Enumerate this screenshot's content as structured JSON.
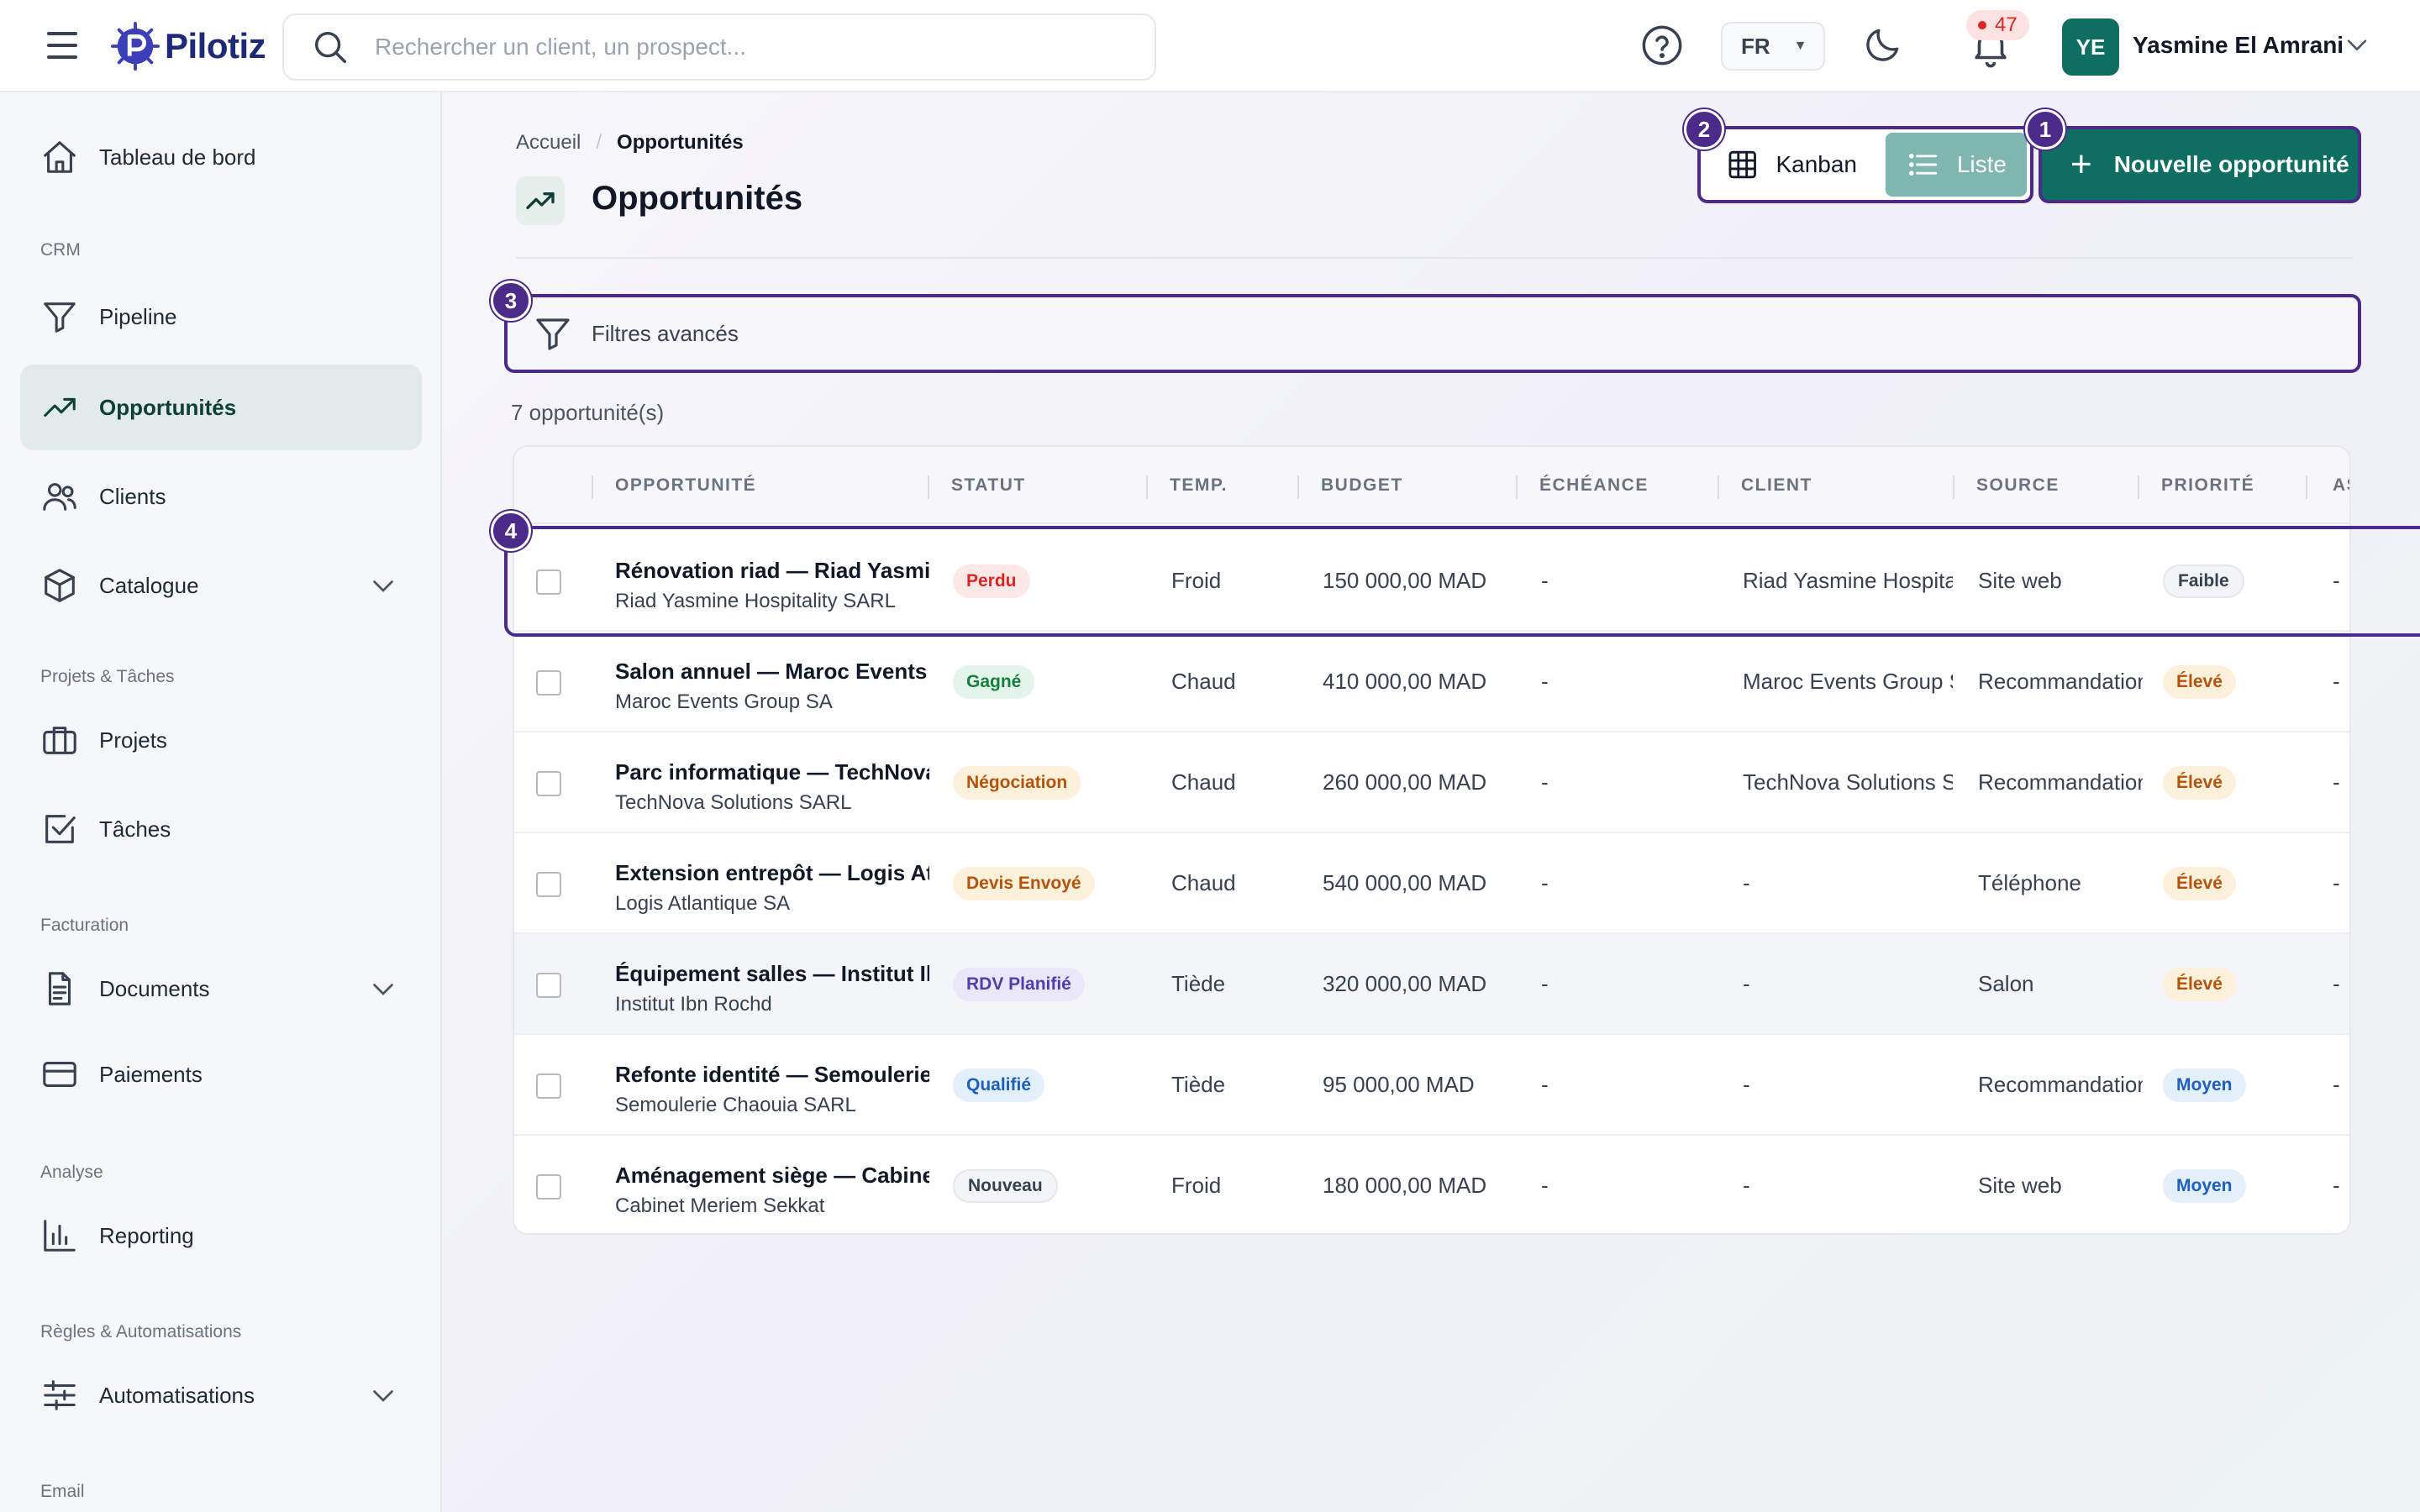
{
  "app": {
    "brand": "Pilotiz",
    "search_placeholder": "Rechercher un client, un prospect...",
    "language": "FR",
    "notifications_count": "47",
    "user_initials": "YE",
    "user_name": "Yasmine El Amrani"
  },
  "sidebar": {
    "items": [
      {
        "label": "Tableau de bord",
        "icon": "home-icon"
      },
      {
        "label": "Pipeline",
        "icon": "filter-icon"
      },
      {
        "label": "Opportunités",
        "icon": "trending-up-icon",
        "active": true
      },
      {
        "label": "Clients",
        "icon": "users-icon"
      },
      {
        "label": "Catalogue",
        "icon": "box-icon"
      },
      {
        "label": "Projets",
        "icon": "briefcase-icon"
      },
      {
        "label": "Tâches",
        "icon": "checkbox-icon"
      },
      {
        "label": "Documents",
        "icon": "document-icon"
      },
      {
        "label": "Paiements",
        "icon": "credit-card-icon"
      },
      {
        "label": "Reporting",
        "icon": "bar-chart-icon"
      },
      {
        "label": "Automatisations",
        "icon": "sliders-icon"
      }
    ],
    "sections": [
      "CRM",
      "Projets & Tâches",
      "Facturation",
      "Analyse",
      "Règles & Automatisations",
      "Email"
    ]
  },
  "page": {
    "breadcrumb_home": "Accueil",
    "breadcrumb_current": "Opportunités",
    "title": "Opportunités",
    "view_kanban": "Kanban",
    "view_list": "Liste",
    "new_button": "Nouvelle opportunité",
    "filters_label": "Filtres avancés",
    "count_label": "7 opportunité(s)",
    "markers": [
      "1",
      "2",
      "3",
      "4"
    ]
  },
  "table": {
    "columns": [
      "OPPORTUNITÉ",
      "STATUT",
      "TEMP.",
      "BUDGET",
      "ÉCHÉANCE",
      "CLIENT",
      "SOURCE",
      "PRIORITÉ",
      "AS"
    ],
    "rows": [
      {
        "title": "Rénovation riad — Riad Yasmine",
        "company": "Riad Yasmine Hospitality SARL",
        "status": "Perdu",
        "temp": "Froid",
        "budget": "150 000,00 MAD",
        "due": "-",
        "client": "Riad Yasmine Hospitality",
        "source": "Site web",
        "priority": "Faible",
        "assignee": "-"
      },
      {
        "title": "Salon annuel — Maroc Events Group",
        "company": "Maroc Events Group SA",
        "status": "Gagné",
        "temp": "Chaud",
        "budget": "410 000,00 MAD",
        "due": "-",
        "client": "Maroc Events Group SA",
        "source": "Recommandation",
        "priority": "Élevé",
        "assignee": "-"
      },
      {
        "title": "Parc informatique — TechNova",
        "company": "TechNova Solutions SARL",
        "status": "Négociation",
        "temp": "Chaud",
        "budget": "260 000,00 MAD",
        "due": "-",
        "client": "TechNova Solutions SARL",
        "source": "Recommandation",
        "priority": "Élevé",
        "assignee": "-"
      },
      {
        "title": "Extension entrepôt — Logis Atlantique",
        "company": "Logis Atlantique SA",
        "status": "Devis Envoyé",
        "temp": "Chaud",
        "budget": "540 000,00 MAD",
        "due": "-",
        "client": "-",
        "source": "Téléphone",
        "priority": "Élevé",
        "assignee": "-"
      },
      {
        "title": "Équipement salles — Institut Ibn Rochd",
        "company": "Institut Ibn Rochd",
        "status": "RDV Planifié",
        "temp": "Tiède",
        "budget": "320 000,00 MAD",
        "due": "-",
        "client": "-",
        "source": "Salon",
        "priority": "Élevé",
        "assignee": "-"
      },
      {
        "title": "Refonte identité — Semoulerie Chaouia",
        "company": "Semoulerie Chaouia SARL",
        "status": "Qualifié",
        "temp": "Tiède",
        "budget": "95 000,00 MAD",
        "due": "-",
        "client": "-",
        "source": "Recommandation",
        "priority": "Moyen",
        "assignee": "-"
      },
      {
        "title": "Aménagement siège — Cabinet Meriem Sekkat",
        "company": "Cabinet Meriem Sekkat",
        "status": "Nouveau",
        "temp": "Froid",
        "budget": "180 000,00 MAD",
        "due": "-",
        "client": "-",
        "source": "Site web",
        "priority": "Moyen",
        "assignee": "-"
      }
    ]
  },
  "colors": {
    "brand": "#0f6e62",
    "annotation": "#4c2a8a",
    "status": {
      "Perdu": [
        "#fde8e8",
        "#dc2626"
      ],
      "Gagné": [
        "#e3f5ea",
        "#15803d"
      ],
      "Négociation": [
        "#fdf1dc",
        "#b45309"
      ],
      "Devis Envoyé": [
        "#fdf1dc",
        "#b45309"
      ],
      "RDV Planifié": [
        "#ebe7fb",
        "#4c3fb0"
      ],
      "Qualifié": [
        "#e4effc",
        "#1d5fbf"
      ],
      "Nouveau": [
        "#f3f4f6",
        "#374151"
      ]
    },
    "priority": {
      "Faible": [
        "#f3f4f6",
        "#374151"
      ],
      "Élevé": [
        "#fdf1dc",
        "#b45309"
      ],
      "Moyen": [
        "#e4effc",
        "#1d5fbf"
      ]
    }
  }
}
